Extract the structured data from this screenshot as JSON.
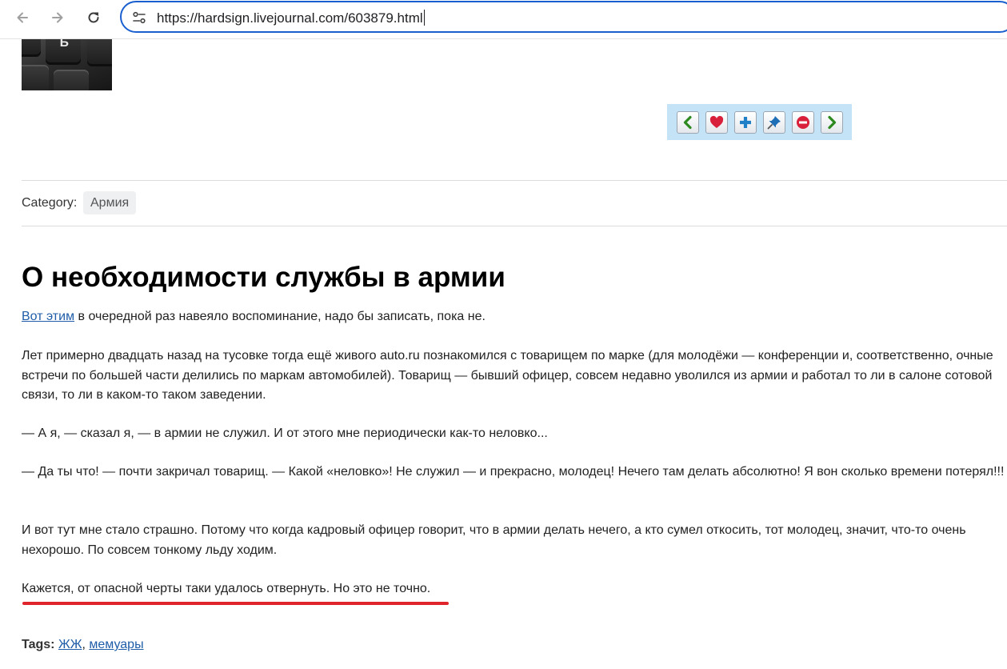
{
  "browser": {
    "url": "https://hardsign.livejournal.com/603879.html"
  },
  "userpic": {
    "key_glyph": "Ъ"
  },
  "actions": [
    {
      "name": "prev-entry-button",
      "icon": "chevron-left-icon",
      "color": "#2c8a1f"
    },
    {
      "name": "favorite-button",
      "icon": "heart-icon",
      "color": "#d9203a"
    },
    {
      "name": "add-button",
      "icon": "plus-icon",
      "color": "#1f7fc7"
    },
    {
      "name": "pin-button",
      "icon": "pin-icon",
      "color": "#1f6fb7"
    },
    {
      "name": "block-button",
      "icon": "minus-circle-icon",
      "color": "#d9203a"
    },
    {
      "name": "next-entry-button",
      "icon": "chevron-right-icon",
      "color": "#2c8a1f"
    }
  ],
  "category": {
    "label": "Category:",
    "value": "Армия"
  },
  "post": {
    "title": "О необходимости службы в армии",
    "intro_link": "Вот этим",
    "intro_rest": " в очередной раз навеяло воспоминание, надо бы записать, пока не.",
    "p2": "Лет примерно двадцать назад на тусовке тогда ещё живого auto.ru познакомился с товарищем по марке (для молодёжи — конференции и, соответственно, очные встречи по большей части делились по маркам автомобилей). Товарищ — бывший офицер, совсем недавно уволился из армии и работал то ли в салоне сотовой связи, то ли в каком-то таком заведении.",
    "p3": "— А я, — сказал я, — в армии не служил. И от этого мне периодически как-то неловко...",
    "p4": "— Да ты что! — почти закричал товарищ. — Какой «неловко»! Не служил — и прекрасно, молодец! Нечего там делать абсолютно! Я вон сколько времени потерял!!!",
    "p5": "И вот тут мне стало страшно. Потому что когда кадровый офицер говорит, что в армии делать нечего, а кто сумел откосить, тот молодец, значит, что-то очень нехорошо. По совсем тонкому льду ходим.",
    "p6": "Кажется, от опасной черты таки удалось отвернуть. Но это не точно."
  },
  "tags": {
    "label": "Tags:",
    "items": [
      "ЖЖ",
      "мемуары"
    ],
    "separator": ", "
  },
  "colors": {
    "address_border": "#1a5fd0",
    "link": "#1f5da8",
    "actions_bg": "#c4e3f7",
    "red_underline": "#e0242b"
  }
}
